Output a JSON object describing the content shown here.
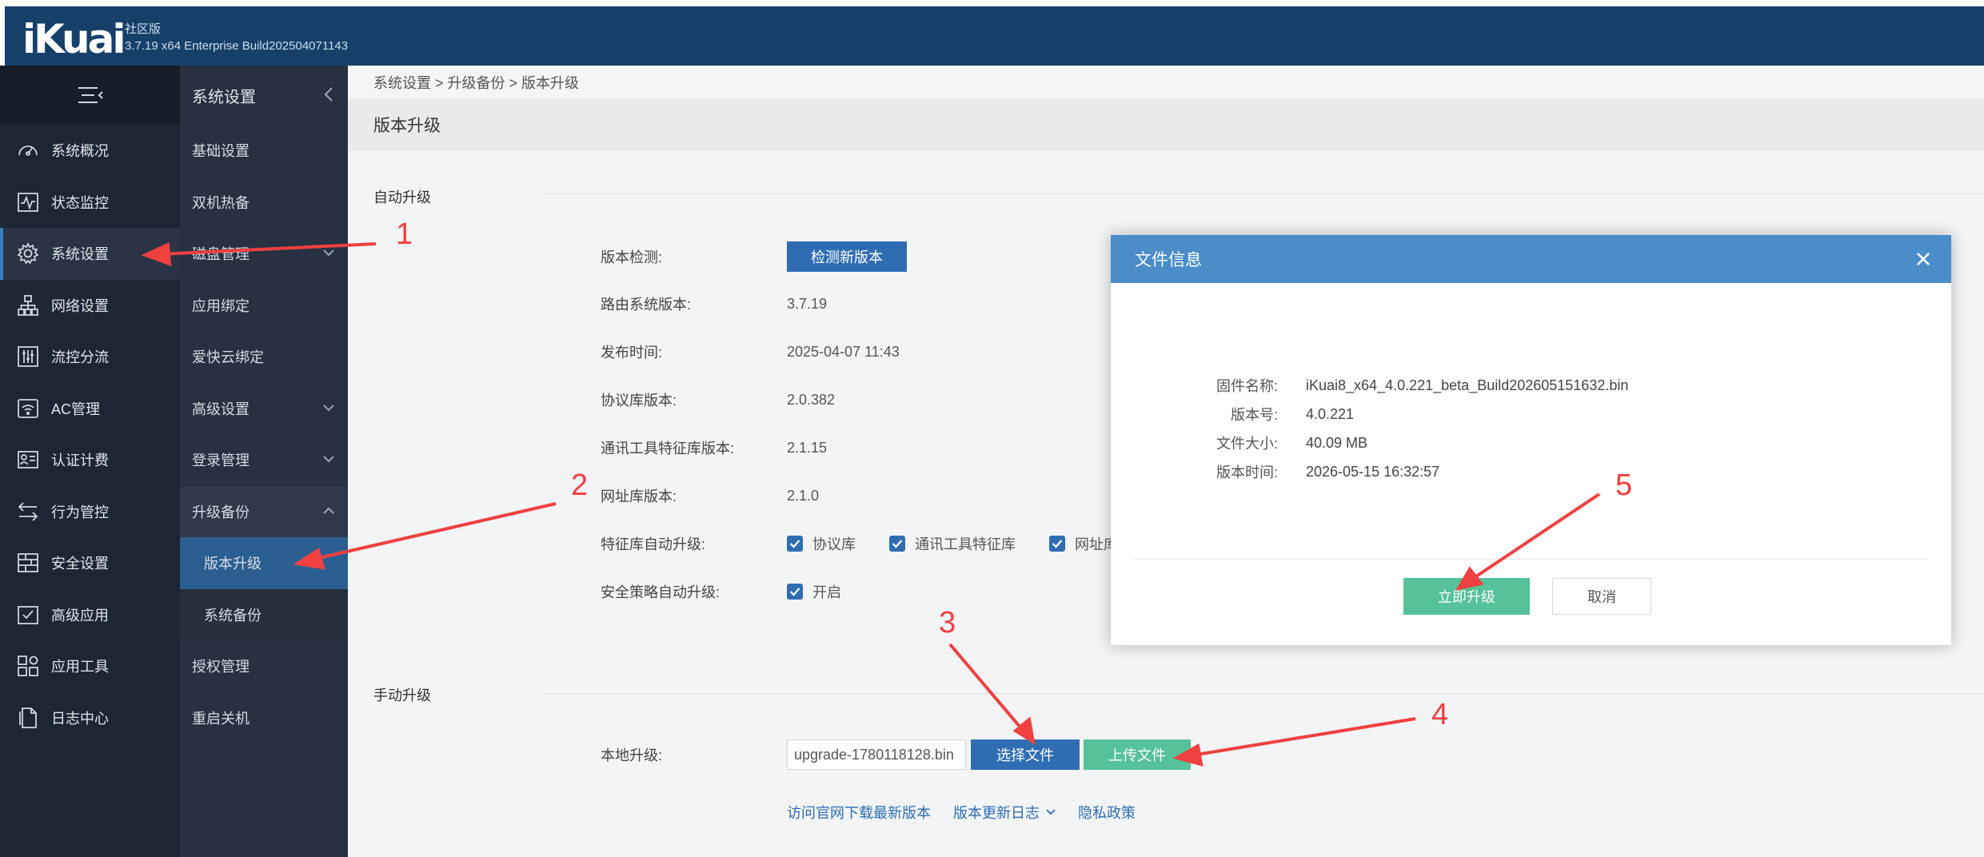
{
  "header": {
    "logo": "iKuai",
    "edition": "社区版",
    "build": "3.7.19 x64 Enterprise Build202504071143"
  },
  "nav": {
    "items": [
      {
        "label": "系统概况",
        "icon": "gauge-icon"
      },
      {
        "label": "状态监控",
        "icon": "pulse-monitor-icon"
      },
      {
        "label": "系统设置",
        "icon": "gear-icon"
      },
      {
        "label": "网络设置",
        "icon": "network-tree-icon"
      },
      {
        "label": "流控分流",
        "icon": "sliders-icon"
      },
      {
        "label": "AC管理",
        "icon": "wifi-icon"
      },
      {
        "label": "认证计费",
        "icon": "id-card-icon"
      },
      {
        "label": "行为管控",
        "icon": "arrows-swap-icon"
      },
      {
        "label": "安全设置",
        "icon": "firewall-icon"
      },
      {
        "label": "高级应用",
        "icon": "check-box-icon"
      },
      {
        "label": "应用工具",
        "icon": "tools-grid-icon"
      },
      {
        "label": "日志中心",
        "icon": "document-icon"
      }
    ]
  },
  "subnav": {
    "title": "系统设置",
    "items": [
      {
        "label": "基础设置"
      },
      {
        "label": "双机热备"
      },
      {
        "label": "磁盘管理"
      },
      {
        "label": "应用绑定"
      },
      {
        "label": "爱快云绑定"
      },
      {
        "label": "高级设置"
      },
      {
        "label": "登录管理"
      },
      {
        "label": "升级备份"
      },
      {
        "label": "版本升级"
      },
      {
        "label": "系统备份"
      },
      {
        "label": "授权管理"
      },
      {
        "label": "重启关机"
      }
    ]
  },
  "breadcrumb": "系统设置 > 升级备份 > 版本升级",
  "page_title": "版本升级",
  "auto_upgrade": {
    "heading": "自动升级",
    "version_check_label": "版本检测:",
    "check_button": "检测新版本",
    "router_version_label": "路由系统版本:",
    "router_version": "3.7.19",
    "release_time_label": "发布时间:",
    "release_time": "2025-04-07 11:43",
    "protocol_lib_label": "协议库版本:",
    "protocol_lib": "2.0.382",
    "comm_tool_lib_label": "通讯工具特征库版本:",
    "comm_tool_lib": "2.1.15",
    "url_lib_label": "网址库版本:",
    "url_lib": "2.1.0",
    "feature_auto_label": "特征库自动升级:",
    "feature_options": [
      "协议库",
      "通讯工具特征库",
      "网址库"
    ],
    "security_auto_label": "安全策略自动升级:",
    "security_option": "开启"
  },
  "manual_upgrade": {
    "heading": "手动升级",
    "local_label": "本地升级:",
    "file_value": "upgrade-1780118128.bin",
    "select_button": "选择文件",
    "upload_button": "上传文件",
    "links": [
      "访问官网下载最新版本",
      "版本更新日志",
      "隐私政策"
    ]
  },
  "modal": {
    "title": "文件信息",
    "rows": [
      {
        "k": "固件名称:",
        "v": "iKuai8_x64_4.0.221_beta_Build202605151632.bin"
      },
      {
        "k": "版本号:",
        "v": "4.0.221"
      },
      {
        "k": "文件大小:",
        "v": "40.09 MB"
      },
      {
        "k": "版本时间:",
        "v": "2026-05-15 16:32:57"
      }
    ],
    "confirm": "立即升级",
    "cancel": "取消"
  },
  "annotations": {
    "color": "#f04040",
    "steps": [
      "1",
      "2",
      "3",
      "4",
      "5"
    ]
  }
}
